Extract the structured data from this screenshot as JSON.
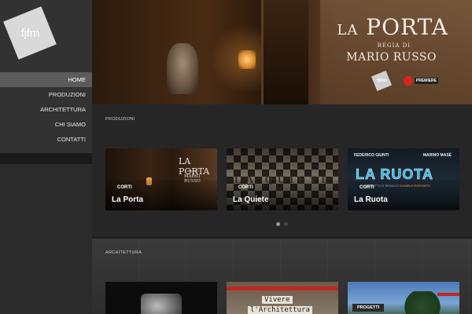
{
  "logo": {
    "text": "fjfm"
  },
  "nav": {
    "items": [
      {
        "label": "HOME",
        "active": true
      },
      {
        "label": "PRODUZIONI",
        "active": false
      },
      {
        "label": "ARCHITETTURA",
        "active": false
      },
      {
        "label": "CHI SIAMO",
        "active": false
      },
      {
        "label": "CONTATTI",
        "active": false
      }
    ]
  },
  "hero": {
    "title_prefix": "LA",
    "title_main": "PORTA",
    "regia": "REGIA DI",
    "director": "MARIO RUSSO",
    "badge_logo": "fjfm",
    "premiere": "PREMIERE"
  },
  "produzioni": {
    "label": "PRODUZIONI",
    "cards": [
      {
        "tag": "CORTI",
        "title": "La Porta",
        "poster_title": "LA PORTA",
        "poster_small": "REGIA DI",
        "poster_dir": "MARIO RUSSO"
      },
      {
        "tag": "CORTI",
        "title": "La Quiete",
        "poster_word": "LA QUIETE"
      },
      {
        "tag": "CORTI",
        "title": "La Ruota",
        "credit_left": "FEDERICO GIUNTI",
        "credit_right": "MARINO MASÈ",
        "poster_word": "LA RUOTA",
        "poster_sub": "SOGGETTO E REGIA DI",
        "poster_sub_name": "DANIELE ESPOSITO"
      }
    ],
    "pager": {
      "pages": 2,
      "current": 1
    }
  },
  "architettura": {
    "label": "ARCHITETTURA",
    "cards": [
      {
        "name": "portrait"
      },
      {
        "word1": "Vivere",
        "word2": "l'Architettura"
      },
      {
        "tag": "PROGETTI"
      }
    ]
  }
}
